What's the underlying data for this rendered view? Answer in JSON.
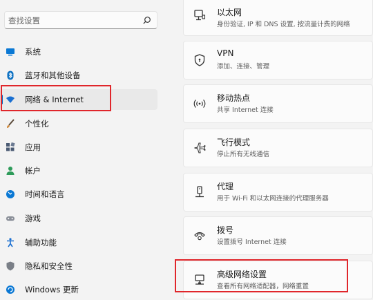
{
  "search": {
    "placeholder": "查找设置",
    "icon": "search-icon"
  },
  "sidebar": {
    "items": [
      {
        "label": "系统",
        "icon": "monitor-icon",
        "color": "#0a78d4"
      },
      {
        "label": "蓝牙和其他设备",
        "icon": "bluetooth-icon",
        "color": "#0a6fc2"
      },
      {
        "label": "网络 & Internet",
        "icon": "wifi-icon",
        "color": "#1a6fd1",
        "selected": true
      },
      {
        "label": "个性化",
        "icon": "brush-icon",
        "color": "#d0893b"
      },
      {
        "label": "应用",
        "icon": "apps-icon",
        "color": "#4a5a73"
      },
      {
        "label": "帐户",
        "icon": "account-icon",
        "color": "#2e9b5a"
      },
      {
        "label": "时间和语言",
        "icon": "globe-clock-icon",
        "color": "#0a78d4"
      },
      {
        "label": "游戏",
        "icon": "gamepad-icon",
        "color": "#8a8f98"
      },
      {
        "label": "辅助功能",
        "icon": "accessibility-icon",
        "color": "#1a6fd1"
      },
      {
        "label": "隐私和安全性",
        "icon": "shield-icon",
        "color": "#7a7f87"
      },
      {
        "label": "Windows 更新",
        "icon": "update-icon",
        "color": "#0a78d4"
      }
    ]
  },
  "cards": [
    {
      "title": "以太网",
      "subtitle": "身份验证, IP 和 DNS 设置, 按流量计费的网络",
      "icon": "ethernet-icon"
    },
    {
      "title": "VPN",
      "subtitle": "添加、连接、管理",
      "icon": "vpn-shield-icon"
    },
    {
      "title": "移动热点",
      "subtitle": "共享 Internet 连接",
      "icon": "hotspot-icon"
    },
    {
      "title": "飞行模式",
      "subtitle": "停止所有无线通信",
      "icon": "airplane-icon"
    },
    {
      "title": "代理",
      "subtitle": "用于 Wi-Fi 和以太网连接的代理服务器",
      "icon": "proxy-icon"
    },
    {
      "title": "拨号",
      "subtitle": "设置拨号 Internet 连接",
      "icon": "dialup-icon"
    },
    {
      "title": "高级网络设置",
      "subtitle": "查看所有网络适配器，网络重置",
      "icon": "advanced-network-icon"
    }
  ],
  "colors": {
    "accent": "#0067c0",
    "highlight": "#e0262b"
  }
}
